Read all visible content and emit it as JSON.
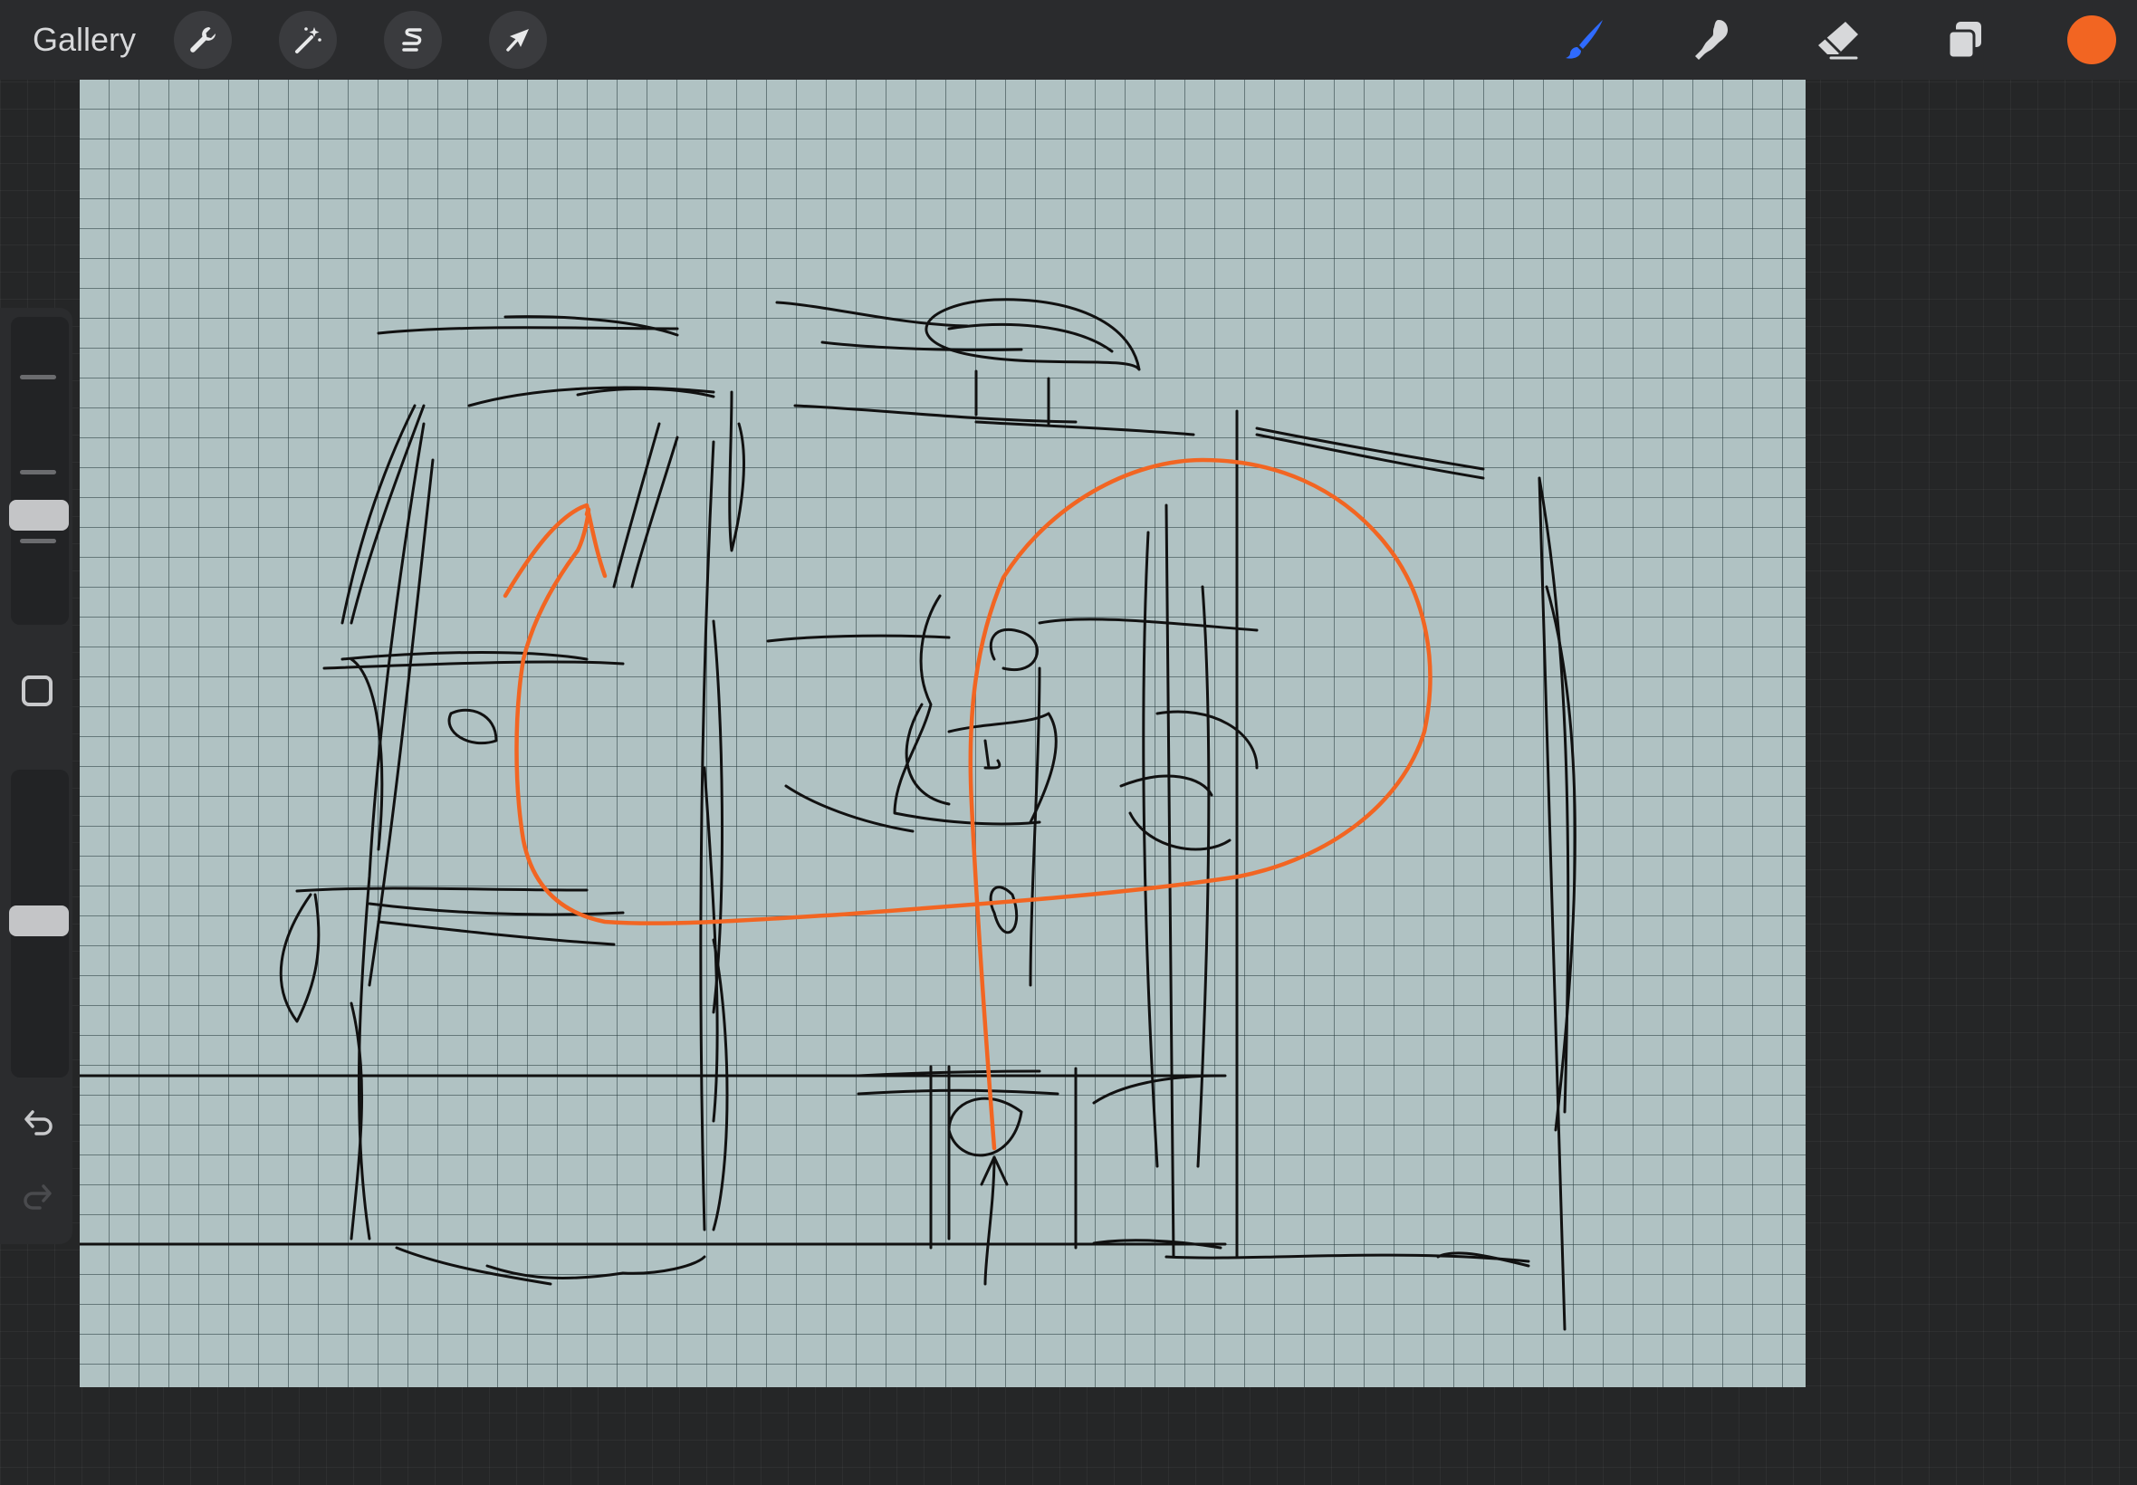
{
  "topbar": {
    "gallery_label": "Gallery",
    "left_tools": [
      {
        "name": "actions",
        "icon": "wrench-icon"
      },
      {
        "name": "adjustments",
        "icon": "magic-wand-icon"
      },
      {
        "name": "selection",
        "icon": "selection-s-icon"
      },
      {
        "name": "transform",
        "icon": "arrow-cursor-icon"
      }
    ],
    "right_tools": [
      {
        "name": "paint",
        "icon": "brush-icon",
        "active": true
      },
      {
        "name": "smudge",
        "icon": "smudge-finger-icon"
      },
      {
        "name": "erase",
        "icon": "eraser-icon"
      },
      {
        "name": "layers",
        "icon": "layers-icon"
      }
    ],
    "current_color": "#f26522"
  },
  "colors": {
    "accent_blue": "#2f6bff",
    "canvas_bg": "#b0c2c3",
    "sketch_black": "#111111",
    "sketch_orange": "#f26522"
  },
  "sidebar": {
    "brush_size_icon": "size-slider",
    "modify_button_icon": "square-modify-icon",
    "opacity_icon": "opacity-slider",
    "undo_icon": "undo-icon",
    "redo_icon": "redo-icon"
  }
}
